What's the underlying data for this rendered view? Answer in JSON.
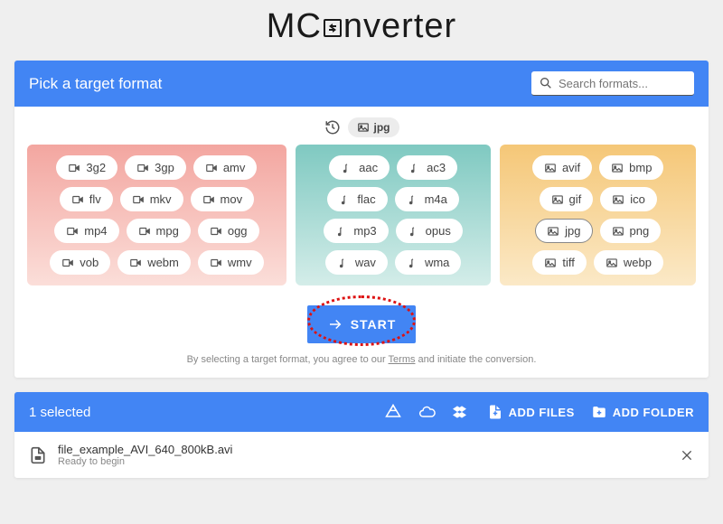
{
  "logo_pre": "MC",
  "logo_post": "nverter",
  "header": {
    "title": "Pick a target format"
  },
  "search": {
    "placeholder": "Search formats..."
  },
  "recent_chip": "jpg",
  "groups": {
    "video": [
      "3g2",
      "3gp",
      "amv",
      "flv",
      "mkv",
      "mov",
      "mp4",
      "mpg",
      "ogg",
      "vob",
      "webm",
      "wmv"
    ],
    "audio": [
      "aac",
      "ac3",
      "flac",
      "m4a",
      "mp3",
      "opus",
      "wav",
      "wma"
    ],
    "image": [
      "avif",
      "bmp",
      "gif",
      "ico",
      "jpg",
      "png",
      "tiff",
      "webp"
    ]
  },
  "selected_format": "jpg",
  "start_label": "START",
  "terms": {
    "pre": "By selecting a target format, you agree to our ",
    "link": "Terms",
    "post": " and initiate the conversion."
  },
  "queue": {
    "selected_text": "1 selected",
    "add_files": "ADD FILES",
    "add_folder": "ADD FOLDER"
  },
  "file": {
    "name": "file_example_AVI_640_800kB.avi",
    "status": "Ready to begin"
  }
}
